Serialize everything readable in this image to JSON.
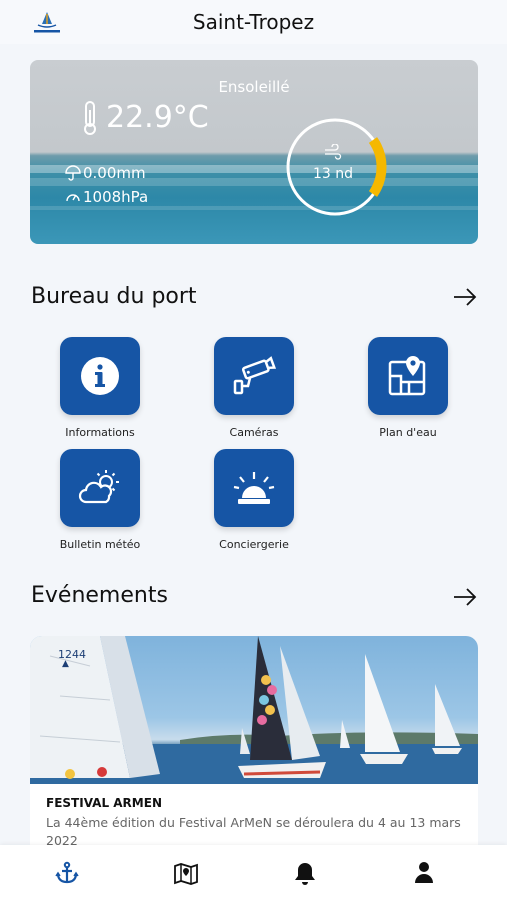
{
  "header": {
    "title": "Saint-Tropez",
    "logo_icon": "saint-tropez-logo"
  },
  "weather": {
    "condition": "Ensoleillé",
    "temperature": "22.9°C",
    "rain": "0.00mm",
    "pressure": "1008hPa",
    "wind": "13 nd",
    "wind_gauge_level": 0.2,
    "accent": "#f5b800"
  },
  "harbor_office": {
    "title": "Bureau du port",
    "arrow_icon": "arrow-right-icon",
    "tiles": [
      {
        "label": "Informations",
        "icon": "info-icon"
      },
      {
        "label": "Caméras",
        "icon": "camera-icon"
      },
      {
        "label": "Plan d'eau",
        "icon": "map-pin-icon"
      },
      {
        "label": "Bulletin météo",
        "icon": "weather-icon"
      },
      {
        "label": "Conciergerie",
        "icon": "siren-icon"
      }
    ]
  },
  "events": {
    "title": "Evénements",
    "arrow_icon": "arrow-right-icon",
    "items": [
      {
        "title": "FESTIVAL ARMEN",
        "description": "La 44ème édition du Festival ArMeN se déroulera du 4 au 13 mars 2022",
        "sail_number": "1244"
      }
    ]
  },
  "bottom_nav": {
    "items": [
      {
        "icon": "anchor-icon",
        "active": true
      },
      {
        "icon": "map-icon",
        "active": false
      },
      {
        "icon": "bell-icon",
        "active": false
      },
      {
        "icon": "user-icon",
        "active": false
      }
    ]
  },
  "colors": {
    "primary": "#1655a5",
    "active_nav": "#1655a5",
    "background": "#f3f6fa"
  }
}
